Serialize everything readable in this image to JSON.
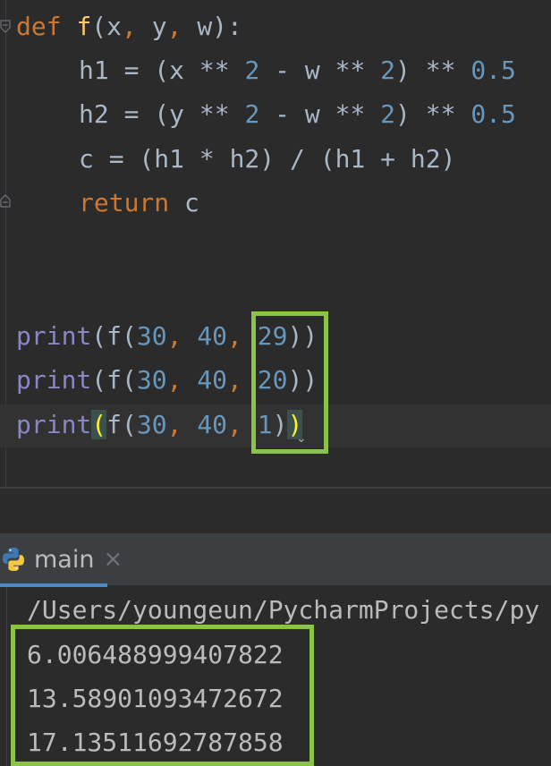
{
  "editor": {
    "def_line": {
      "kw": "def",
      "name": "f",
      "open": "(",
      "p1": "x",
      "c1": ", ",
      "p2": "y",
      "c2": ", ",
      "p3": "w",
      "close": "):"
    },
    "h1_line": {
      "a": "h1 = (x ** ",
      "n1": "2",
      "b": " - w ** ",
      "n2": "2",
      "c": ") ** ",
      "n3": "0.5"
    },
    "h2_line": {
      "a": "h2 = (y ** ",
      "n1": "2",
      "b": " - w ** ",
      "n2": "2",
      "c": ") ** ",
      "n3": "0.5"
    },
    "c_line": "c = (h1 * h2) / (h1 + h2)",
    "return_line": {
      "kw": "return",
      "rest": " c"
    },
    "prints": [
      {
        "fn": "print",
        "open": "(",
        "mid": "f(",
        "n1": "30",
        "s1": ", ",
        "n2": "40",
        "s2": ", ",
        "n3": "29",
        "close1": ")",
        "close2": ")"
      },
      {
        "fn": "print",
        "open": "(",
        "mid": "f(",
        "n1": "30",
        "s1": ", ",
        "n2": "40",
        "s2": ", ",
        "n3": "20",
        "close1": ")",
        "close2": ")"
      },
      {
        "fn": "print",
        "open": "(",
        "mid": "f(",
        "n1": "30",
        "s1": ", ",
        "n2": "40",
        "s2": ", ",
        "n3": "1",
        "close1": ")",
        "close2": ")"
      }
    ]
  },
  "run_panel": {
    "tab_label": "main",
    "tab_close": "×",
    "icon": "python-icon"
  },
  "console": {
    "path": "/Users/youngeun/PycharmProjects/py",
    "outputs": [
      "6.006488999407822",
      "13.58901093472672",
      "17.1351169278785​8"
    ]
  },
  "colors": {
    "highlight_box": "#8bc34a",
    "keyword": "#cc7832",
    "function": "#ffc66d",
    "number": "#6897bb",
    "builtin": "#8888c6"
  }
}
